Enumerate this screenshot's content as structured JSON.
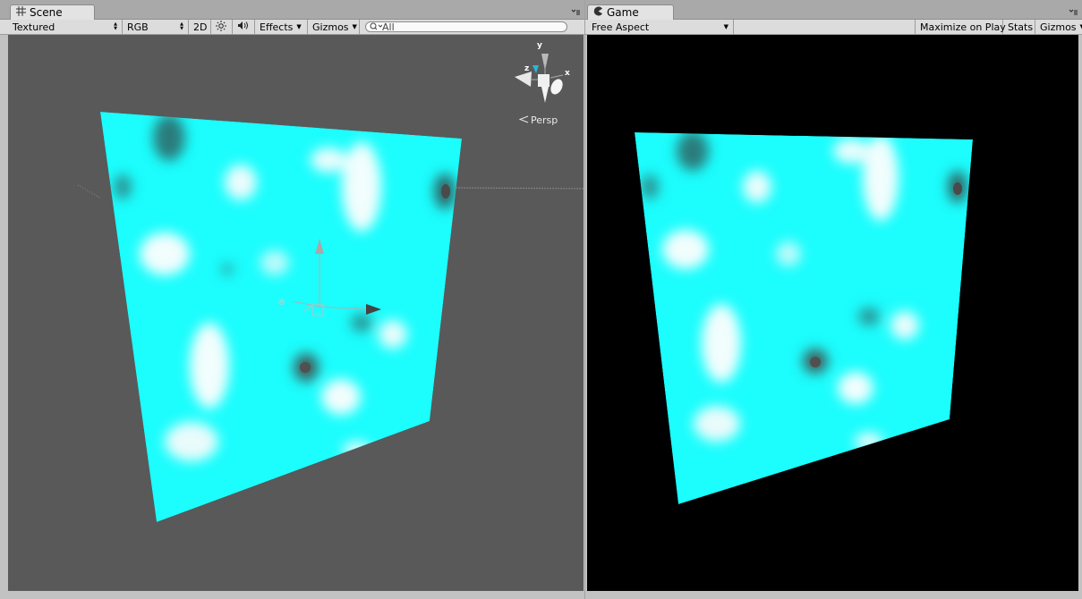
{
  "scene": {
    "tab_label": "Scene",
    "toolbar": {
      "draw_mode": "Textured",
      "render_mode": "RGB",
      "mode_2d_label": "2D",
      "effects_label": "Effects",
      "gizmos_label": "Gizmos",
      "search_placeholder": "All"
    },
    "persp_label": "Persp",
    "gizmo_axes": {
      "y": "y",
      "x": "x",
      "z": "z"
    }
  },
  "game": {
    "tab_label": "Game",
    "toolbar": {
      "aspect": "Free Aspect",
      "maximize_label": "Maximize on Play",
      "stats_label": "Stats",
      "gizmos_label": "Gizmos"
    }
  },
  "icons": {
    "scene_tab": "grid-icon",
    "game_tab": "pacman-icon",
    "lighting": "sun-icon",
    "audio": "speaker-icon",
    "panel_menu": "menu-icon"
  },
  "colors": {
    "plane_cyan": "#1cfdfd",
    "plane_highlight": "#eafcfc",
    "plane_shadow": "#3c6a6a",
    "scene_bg": "#595959",
    "game_bg": "#000000"
  }
}
